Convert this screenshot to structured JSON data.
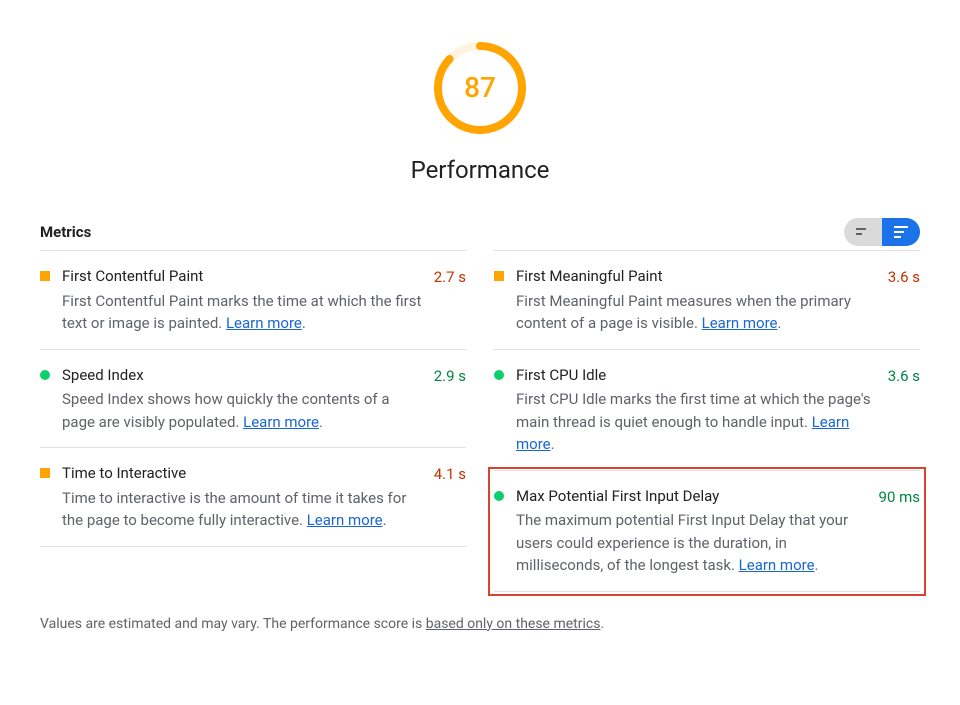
{
  "gauge": {
    "score": "87",
    "percent": 0.87,
    "color": "#ffa400",
    "title": "Performance"
  },
  "metrics_label": "Metrics",
  "learn_more_label": "Learn more",
  "left": [
    {
      "marker": "square",
      "title": "First Contentful Paint",
      "desc": "First Contentful Paint marks the time at which the first text or image is painted. ",
      "value": "2.7 s",
      "valueClass": "avg"
    },
    {
      "marker": "circle",
      "title": "Speed Index",
      "desc": "Speed Index shows how quickly the contents of a page are visibly populated. ",
      "value": "2.9 s",
      "valueClass": "fast"
    },
    {
      "marker": "square",
      "title": "Time to Interactive",
      "desc": "Time to interactive is the amount of time it takes for the page to become fully interactive. ",
      "value": "4.1 s",
      "valueClass": "avg"
    }
  ],
  "right": [
    {
      "marker": "square",
      "title": "First Meaningful Paint",
      "desc": "First Meaningful Paint measures when the primary content of a page is visible. ",
      "value": "3.6 s",
      "valueClass": "avg"
    },
    {
      "marker": "circle",
      "title": "First CPU Idle",
      "desc": "First CPU Idle marks the first time at which the page's main thread is quiet enough to handle input. ",
      "value": "3.6 s",
      "valueClass": "fast"
    },
    {
      "marker": "circle",
      "title": "Max Potential First Input Delay",
      "desc": "The maximum potential First Input Delay that your users could experience is the duration, in milliseconds, of the longest task. ",
      "value": "90 ms",
      "valueClass": "fast"
    }
  ],
  "footnote": {
    "prefix": "Values are estimated and may vary. The performance score is ",
    "link": "based only on these metrics",
    "suffix": "."
  }
}
